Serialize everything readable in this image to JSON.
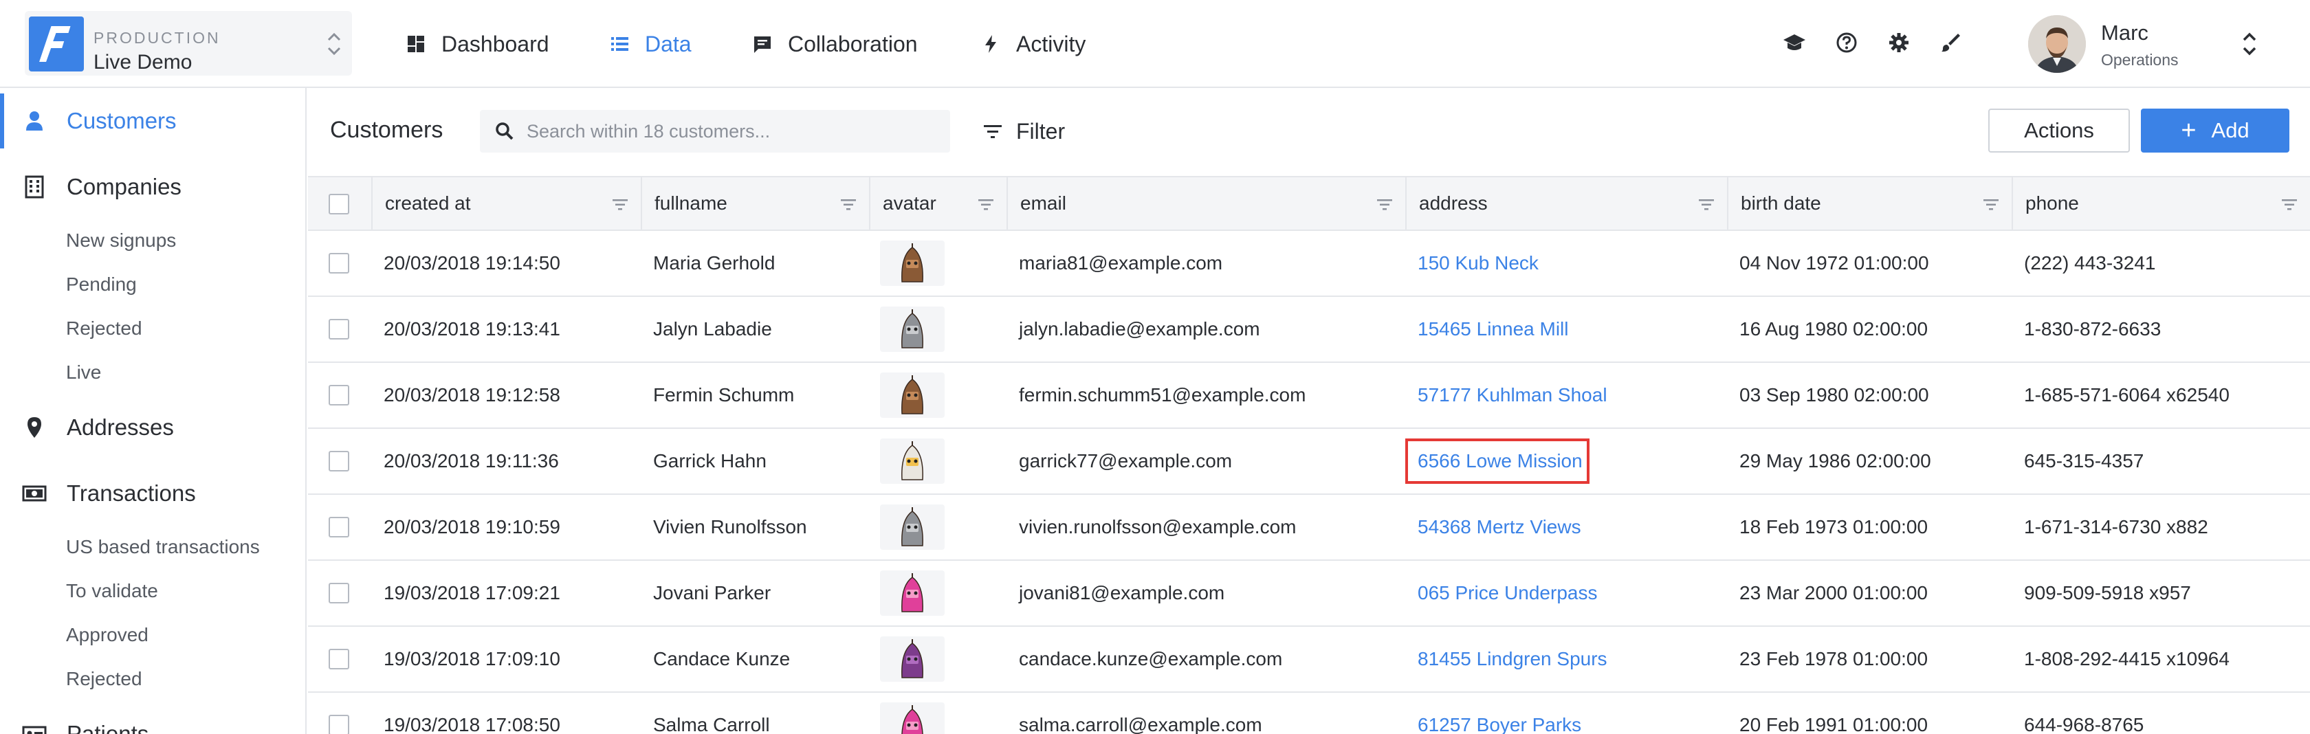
{
  "project": {
    "environment": "PRODUCTION",
    "name": "Live Demo"
  },
  "nav": [
    {
      "label": "Dashboard",
      "icon": "dashboard-icon"
    },
    {
      "label": "Data",
      "icon": "list-icon",
      "active": true
    },
    {
      "label": "Collaboration",
      "icon": "comment-icon"
    },
    {
      "label": "Activity",
      "icon": "bolt-icon"
    }
  ],
  "topbar_icons": [
    "graduation-cap-icon",
    "help-icon",
    "gear-icon",
    "brush-icon"
  ],
  "user": {
    "name": "Marc",
    "role": "Operations"
  },
  "sidebar": {
    "customers": "Customers",
    "companies": "Companies",
    "companies_sub": [
      "New signups",
      "Pending",
      "Rejected",
      "Live"
    ],
    "addresses": "Addresses",
    "transactions": "Transactions",
    "transactions_sub": [
      "US based transactions",
      "To validate",
      "Approved",
      "Rejected"
    ],
    "patients": "Patients"
  },
  "main": {
    "title": "Customers",
    "search_placeholder": "Search within 18 customers...",
    "filter_label": "Filter",
    "actions_label": "Actions",
    "add_label": "Add"
  },
  "table": {
    "columns": [
      "created at",
      "fullname",
      "avatar",
      "email",
      "address",
      "birth date",
      "phone"
    ],
    "rows": [
      {
        "created_at": "20/03/2018 19:14:50",
        "fullname": "Maria Gerhold",
        "avatar": "brown-robot",
        "email": "maria81@example.com",
        "address": "150 Kub Neck",
        "birth_date": "04 Nov 1972 01:00:00",
        "phone": "(222) 443-3241"
      },
      {
        "created_at": "20/03/2018 19:13:41",
        "fullname": "Jalyn Labadie",
        "avatar": "grey-robot",
        "email": "jalyn.labadie@example.com",
        "address": "15465 Linnea Mill",
        "birth_date": "16 Aug 1980 02:00:00",
        "phone": "1-830-872-6633"
      },
      {
        "created_at": "20/03/2018 19:12:58",
        "fullname": "Fermin Schumm",
        "avatar": "brown-robot",
        "email": "fermin.schumm51@example.com",
        "address": "57177 Kuhlman Shoal",
        "birth_date": "03 Sep 1980 02:00:00",
        "phone": "1-685-571-6064 x62540"
      },
      {
        "created_at": "20/03/2018 19:11:36",
        "fullname": "Garrick Hahn",
        "avatar": "white-robot",
        "email": "garrick77@example.com",
        "address": "6566 Lowe Mission",
        "birth_date": "29 May 1986 02:00:00",
        "phone": "645-315-4357",
        "highlighted": true
      },
      {
        "created_at": "20/03/2018 19:10:59",
        "fullname": "Vivien Runolfsson",
        "avatar": "grey-robot",
        "email": "vivien.runolfsson@example.com",
        "address": "54368 Mertz Views",
        "birth_date": "18 Feb 1973 01:00:00",
        "phone": "1-671-314-6730 x882"
      },
      {
        "created_at": "19/03/2018 17:09:21",
        "fullname": "Jovani Parker",
        "avatar": "pink-robot",
        "email": "jovani81@example.com",
        "address": "065 Price Underpass",
        "birth_date": "23 Mar 2000 01:00:00",
        "phone": "909-509-5918 x957"
      },
      {
        "created_at": "19/03/2018 17:09:10",
        "fullname": "Candace Kunze",
        "avatar": "purple-robot",
        "email": "candace.kunze@example.com",
        "address": "81455 Lindgren Spurs",
        "birth_date": "23 Feb 1978 01:00:00",
        "phone": "1-808-292-4415 x10964"
      },
      {
        "created_at": "19/03/2018 17:08:50",
        "fullname": "Salma Carroll",
        "avatar": "pink-robot",
        "email": "salma.carroll@example.com",
        "address": "61257 Boyer Parks",
        "birth_date": "20 Feb 1991 01:00:00",
        "phone": "644-968-8765"
      }
    ]
  },
  "colors": {
    "accent": "#3b82e6",
    "highlight": "#e53935",
    "header_bg": "#f4f5f7"
  }
}
